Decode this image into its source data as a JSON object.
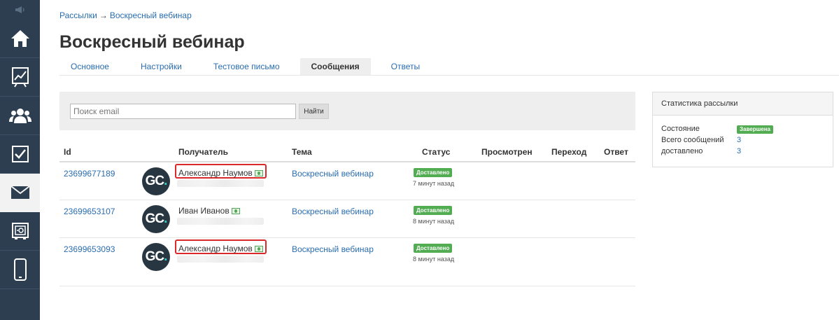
{
  "breadcrumb": {
    "parent": "Рассылки",
    "separator": "→",
    "current": "Воскресный вебинар"
  },
  "page": {
    "title": "Воскресный вебинар"
  },
  "tabs": [
    {
      "label": "Основное"
    },
    {
      "label": "Настройки"
    },
    {
      "label": "Тестовое письмо"
    },
    {
      "label": "Сообщения"
    },
    {
      "label": "Ответы"
    }
  ],
  "active_tab": "Сообщения",
  "search": {
    "placeholder": "Поиск email",
    "button_label": "Найти"
  },
  "table": {
    "headers": {
      "id": "Id",
      "recipient": "Получатель",
      "subject": "Тема",
      "status": "Статус",
      "viewed": "Просмотрен",
      "click": "Переход",
      "reply": "Ответ"
    },
    "rows": [
      {
        "id": "23699677189",
        "avatar": "GC.",
        "recipient": "Александр Наумов",
        "subject": "Воскресный вебинар",
        "status": "Доставлено",
        "time": "7 минут назад",
        "highlighted": true
      },
      {
        "id": "23699653107",
        "avatar": "GC.",
        "recipient": "Иван Иванов",
        "subject": "Воскресный вебинар",
        "status": "Доставлено",
        "time": "8 минут назад",
        "highlighted": false
      },
      {
        "id": "23699653093",
        "avatar": "GC.",
        "recipient": "Александр Наумов",
        "subject": "Воскресный вебинар",
        "status": "Доставлено",
        "time": "8 минут назад",
        "highlighted": true
      }
    ]
  },
  "stats": {
    "title": "Статистика рассылки",
    "state_label": "Состояние",
    "state_value": "Завершена",
    "total_label": "Всего сообщений",
    "total_value": "3",
    "delivered_label": "доставлено",
    "delivered_value": "3"
  },
  "sidebar": {
    "items": [
      {
        "icon": "megaphone-icon"
      },
      {
        "icon": "home-icon"
      },
      {
        "icon": "chart-icon"
      },
      {
        "icon": "users-icon"
      },
      {
        "icon": "tasks-checkbox-icon"
      },
      {
        "icon": "mail-icon",
        "active": true
      },
      {
        "icon": "safe-icon"
      },
      {
        "icon": "mobile-icon"
      }
    ]
  },
  "colors": {
    "sidebar_bg": "#2c3e50",
    "link": "#2a6db0",
    "success": "#52ad52",
    "highlight_border": "#d9292a",
    "avatar_bg": "#283642",
    "avatar_accent": "#2ed1c9"
  }
}
